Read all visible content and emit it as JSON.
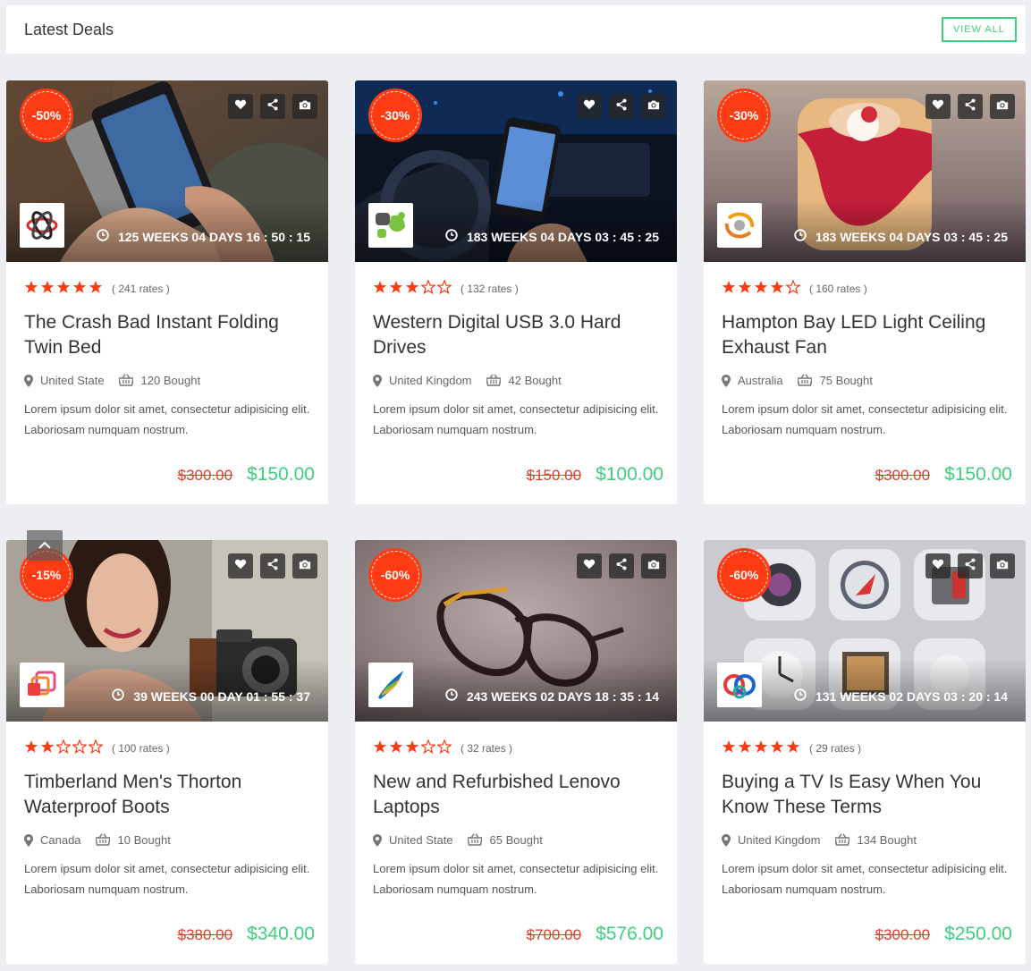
{
  "header": {
    "title": "Latest Deals",
    "view_all": "VIEW ALL"
  },
  "colors": {
    "accent": "#3ecf7e",
    "discount": "#ff3b14",
    "old_price": "#e23b2a",
    "star": "#ff3b14"
  },
  "deals": [
    {
      "discount": "-50%",
      "timer": "125 WEEKS 04 DAYS 16 : 50 : 15",
      "rating": 5,
      "rates": "( 241 rates )",
      "title": "The Crash Bad Instant Folding Twin Bed",
      "location": "United State",
      "bought": "120 Bought",
      "description": "Lorem ipsum dolor sit amet, consectetur adipisicing elit. Laboriosam numquam nostrum.",
      "old_price": "$300.00",
      "new_price": "$150.00",
      "image": "hands-holding-phone",
      "logo": "atom-logo"
    },
    {
      "discount": "-30%",
      "timer": "183 WEEKS 04 DAYS 03 : 45 : 25",
      "rating": 3,
      "rates": "( 132 rates )",
      "title": "Western Digital USB 3.0 Hard Drives",
      "location": "United Kingdom",
      "bought": "42 Bought",
      "description": "Lorem ipsum dolor sit amet, consectetur adipisicing elit. Laboriosam numquam nostrum.",
      "old_price": "$150.00",
      "new_price": "$100.00",
      "image": "phone-in-car",
      "logo": "leaf-logo"
    },
    {
      "discount": "-30%",
      "timer": "183 WEEKS 04 DAYS 03 : 45 : 25",
      "rating": 4,
      "rates": "( 160 rates )",
      "title": "Hampton Bay LED Light Ceiling Exhaust Fan",
      "location": "Australia",
      "bought": "75 Bought",
      "description": "Lorem ipsum dolor sit amet, consectetur adipisicing elit. Laboriosam numquam nostrum.",
      "old_price": "$300.00",
      "new_price": "$150.00",
      "image": "dessert-icon",
      "logo": "ring-logo"
    },
    {
      "discount": "-15%",
      "timer": "39 WEEKS 00 DAY 01 : 55 : 37",
      "rating": 2,
      "rates": "( 100 rates )",
      "title": "Timberland Men's Thorton Waterproof Boots",
      "location": "Canada",
      "bought": "10 Bought",
      "description": "Lorem ipsum dolor sit amet, consectetur adipisicing elit. Laboriosam numquam nostrum.",
      "old_price": "$380.00",
      "new_price": "$340.00",
      "image": "woman-with-camera",
      "logo": "squares-logo"
    },
    {
      "discount": "-60%",
      "timer": "243 WEEKS 02 DAYS 18 : 35 : 14",
      "rating": 3,
      "rates": "( 32 rates )",
      "title": "New and Refurbished Lenovo Laptops",
      "location": "United State",
      "bought": "65 Bought",
      "description": "Lorem ipsum dolor sit amet, consectetur adipisicing elit. Laboriosam numquam nostrum.",
      "old_price": "$700.00",
      "new_price": "$576.00",
      "image": "eyeglasses",
      "logo": "swoosh-logo"
    },
    {
      "discount": "-60%",
      "timer": "131 WEEKS 02 DAYS 03 : 20 : 14",
      "rating": 5,
      "rates": "( 29 rates )",
      "title": "Buying a TV Is Easy When You Know These Terms",
      "location": "United Kingdom",
      "bought": "134 Bought",
      "description": "Lorem ipsum dolor sit amet, consectetur adipisicing elit. Laboriosam numquam nostrum.",
      "old_price": "$300.00",
      "new_price": "$250.00",
      "image": "app-icons",
      "logo": "links-logo"
    }
  ]
}
